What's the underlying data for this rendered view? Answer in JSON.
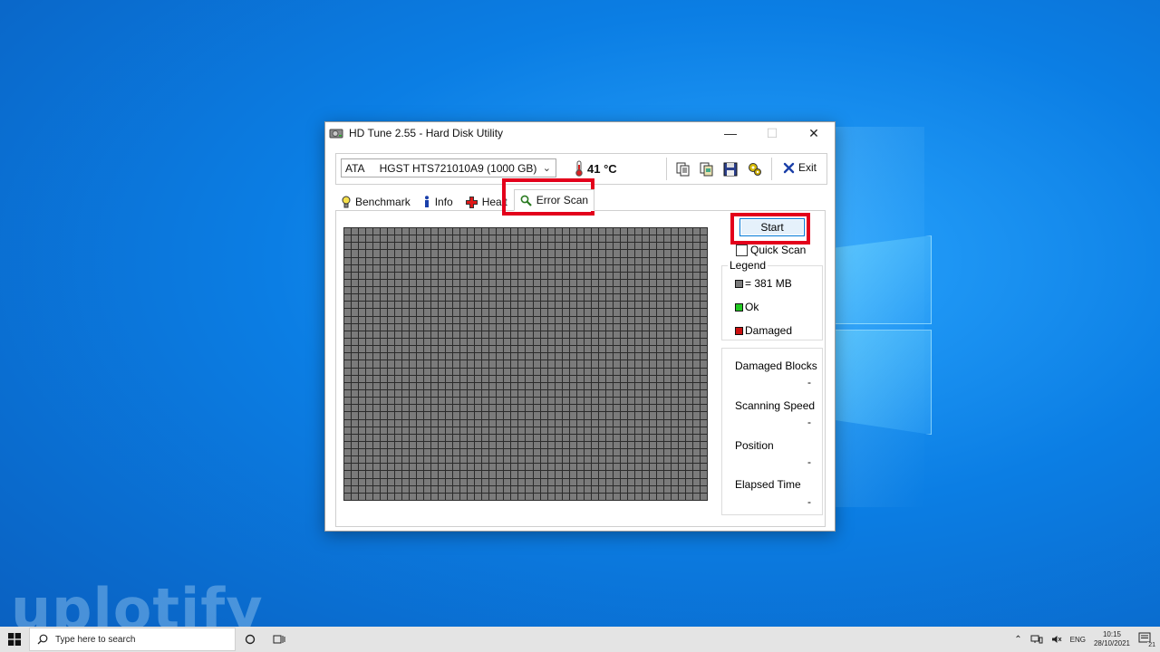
{
  "desktop": {
    "watermark": "uplotify"
  },
  "window": {
    "title": "HD Tune 2.55 - Hard Disk Utility",
    "controls": {
      "minimize": "—",
      "maximize": "☐",
      "close": "✕"
    }
  },
  "toolbar": {
    "drive": "ATA     HGST HTS721010A9 (1000 GB)",
    "temperature": "41 °C",
    "exit_label": "Exit"
  },
  "tabs": [
    {
      "label": "Benchmark",
      "icon": "lightbulb-icon"
    },
    {
      "label": "Info",
      "icon": "info-icon"
    },
    {
      "label": "Healt",
      "icon": "health-cross-icon"
    },
    {
      "label": "Error Scan",
      "icon": "magnifier-icon",
      "active": true
    }
  ],
  "scan": {
    "start_label": "Start",
    "quick_scan_label": "Quick Scan",
    "quick_scan_checked": false,
    "legend": {
      "caption": "Legend",
      "block": "= 381 MB",
      "ok": "Ok",
      "damaged": "Damaged"
    },
    "stats": {
      "damaged_blocks_label": "Damaged Blocks",
      "damaged_blocks_value": "-",
      "speed_label": "Scanning Speed",
      "speed_value": "-",
      "position_label": "Position",
      "position_value": "-",
      "elapsed_label": "Elapsed Time",
      "elapsed_value": "-"
    }
  },
  "colors": {
    "block_grey": "#7b7b7b",
    "ok_green": "#22c922",
    "damaged_red": "#cc1111",
    "highlight": "#e3001b"
  },
  "taskbar": {
    "search_placeholder": "Type here to search",
    "language": "ENG",
    "time": "10:15",
    "date": "28/10/2021",
    "notification_count": "21"
  }
}
